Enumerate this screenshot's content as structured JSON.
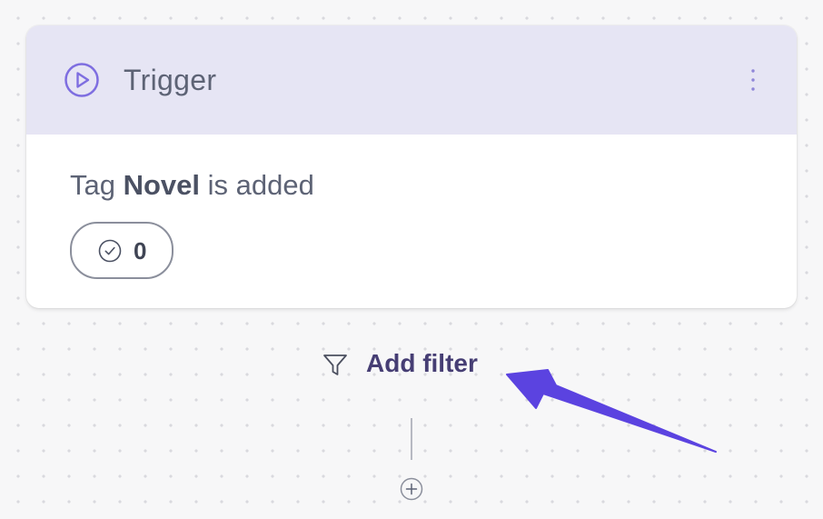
{
  "trigger_card": {
    "title": "Trigger",
    "description": {
      "prefix": "Tag",
      "tag_name": "Novel",
      "suffix": "is added"
    },
    "completed_count": "0"
  },
  "filter": {
    "label": "Add filter"
  },
  "icons": {
    "trigger": "play-circle-icon",
    "menu": "kebab-menu-icon",
    "count": "check-circle-icon",
    "filter": "funnel-icon",
    "add_step": "plus-circle-icon"
  },
  "colors": {
    "header_background": "#e6e5f4",
    "accent": "#7e6ee0",
    "filter_text": "#463e74",
    "annotation_arrow": "#5b43e0"
  }
}
